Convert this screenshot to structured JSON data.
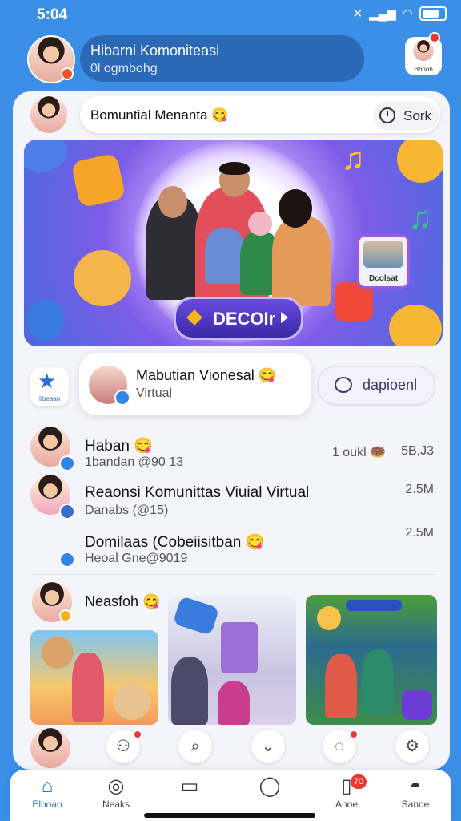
{
  "status_bar": {
    "time": "5:04"
  },
  "header": {
    "pill_title": "Hibarni Komoniteasi",
    "pill_subtitle": "0l ogmbohg",
    "right_caption": "Hbnoh"
  },
  "search_row": {
    "title": "Bomuntial Menanta",
    "emoji": "😋",
    "sort_label": "Sork"
  },
  "banner": {
    "button_label": "DECOIr",
    "photo_badge_caption": "Dcolsat"
  },
  "community": {
    "star_caption": "Iibeaan",
    "title": "Mabutian Vionesal",
    "title_emoji": "😋",
    "subtitle": "Virtual",
    "join_label": "dapioenl"
  },
  "list": [
    {
      "name": "Haban",
      "emoji": "😋",
      "sub": "1bandan @90 13",
      "meta": "1 oukl 🍩",
      "right": "5B,J3"
    },
    {
      "name": "Reaonsi Komunittas  Viuial Virtual",
      "emoji": "",
      "sub": "Danabs (@15)",
      "meta": "",
      "right": "2.5M"
    },
    {
      "name": "Domilaas (Cobeiisitban",
      "emoji": "😋",
      "sub": "Heoal Gne@9019",
      "meta": "",
      "right": "2.5M"
    }
  ],
  "nearby": {
    "label": "Neasfoh",
    "emoji": "😋"
  },
  "nav": [
    {
      "label": "Elboao",
      "icon": "⌂"
    },
    {
      "label": "Neaks",
      "icon": "◎"
    },
    {
      "label": "",
      "icon": "▭"
    },
    {
      "label": "",
      "icon": "◯"
    },
    {
      "label": "Anoe",
      "icon": "▯",
      "badge": "70"
    },
    {
      "label": "Sanoe",
      "icon": "◓"
    }
  ],
  "colors": {
    "accent": "#2b74df",
    "header_bg": "#3b8fe6",
    "badge": "#e53935"
  }
}
